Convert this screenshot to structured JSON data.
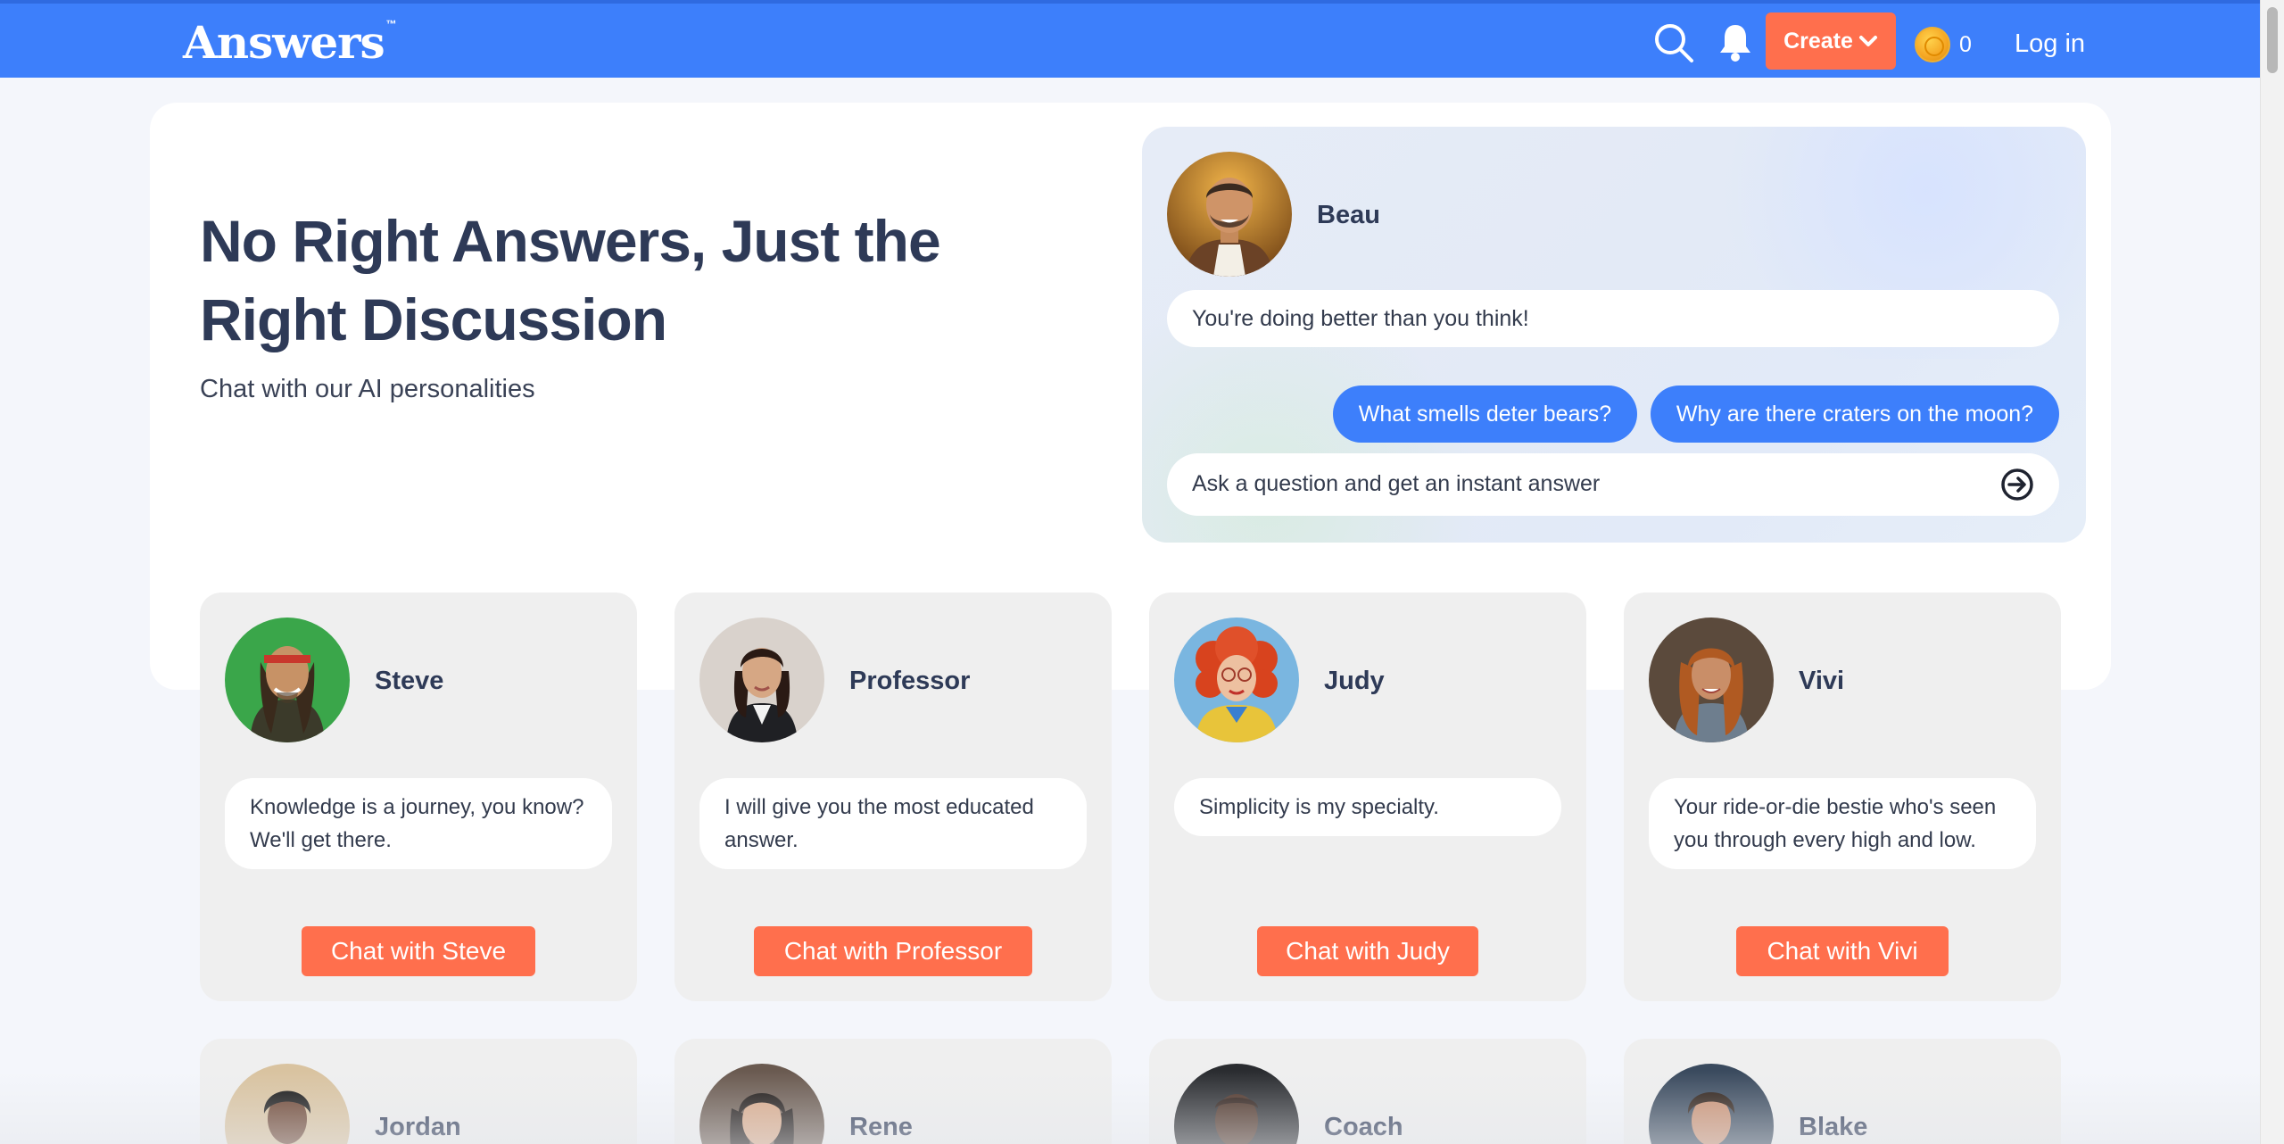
{
  "header": {
    "logo": "Answers",
    "logo_tm": "™",
    "create_label": "Create",
    "coin_count": "0",
    "login_label": "Log in",
    "brand_color": "#3d7ffb",
    "accent_color": "#ff6f4d"
  },
  "hero": {
    "title": "No Right Answers, Just the Right Discussion",
    "subtitle": "Chat with our AI personalities"
  },
  "demo": {
    "persona_name": "Beau",
    "greeting": "You're doing better than you think!",
    "suggestions": [
      "What smells deter bears?",
      "Why are there craters on the moon?"
    ],
    "input_placeholder": "Ask a question and get an instant answer"
  },
  "personas": [
    {
      "name": "Steve",
      "quote": "Knowledge is a journey, you know? We'll get there.",
      "button": "Chat with Steve"
    },
    {
      "name": "Professor",
      "quote": "I will give you the most educated answer.",
      "button": "Chat with Professor"
    },
    {
      "name": "Judy",
      "quote": "Simplicity is my specialty.",
      "button": "Chat with Judy"
    },
    {
      "name": "Vivi",
      "quote": "Your ride-or-die bestie who's seen you through every high and low.",
      "button": "Chat with Vivi"
    },
    {
      "name": "Jordan"
    },
    {
      "name": "Rene"
    },
    {
      "name": "Coach"
    },
    {
      "name": "Blake"
    }
  ]
}
